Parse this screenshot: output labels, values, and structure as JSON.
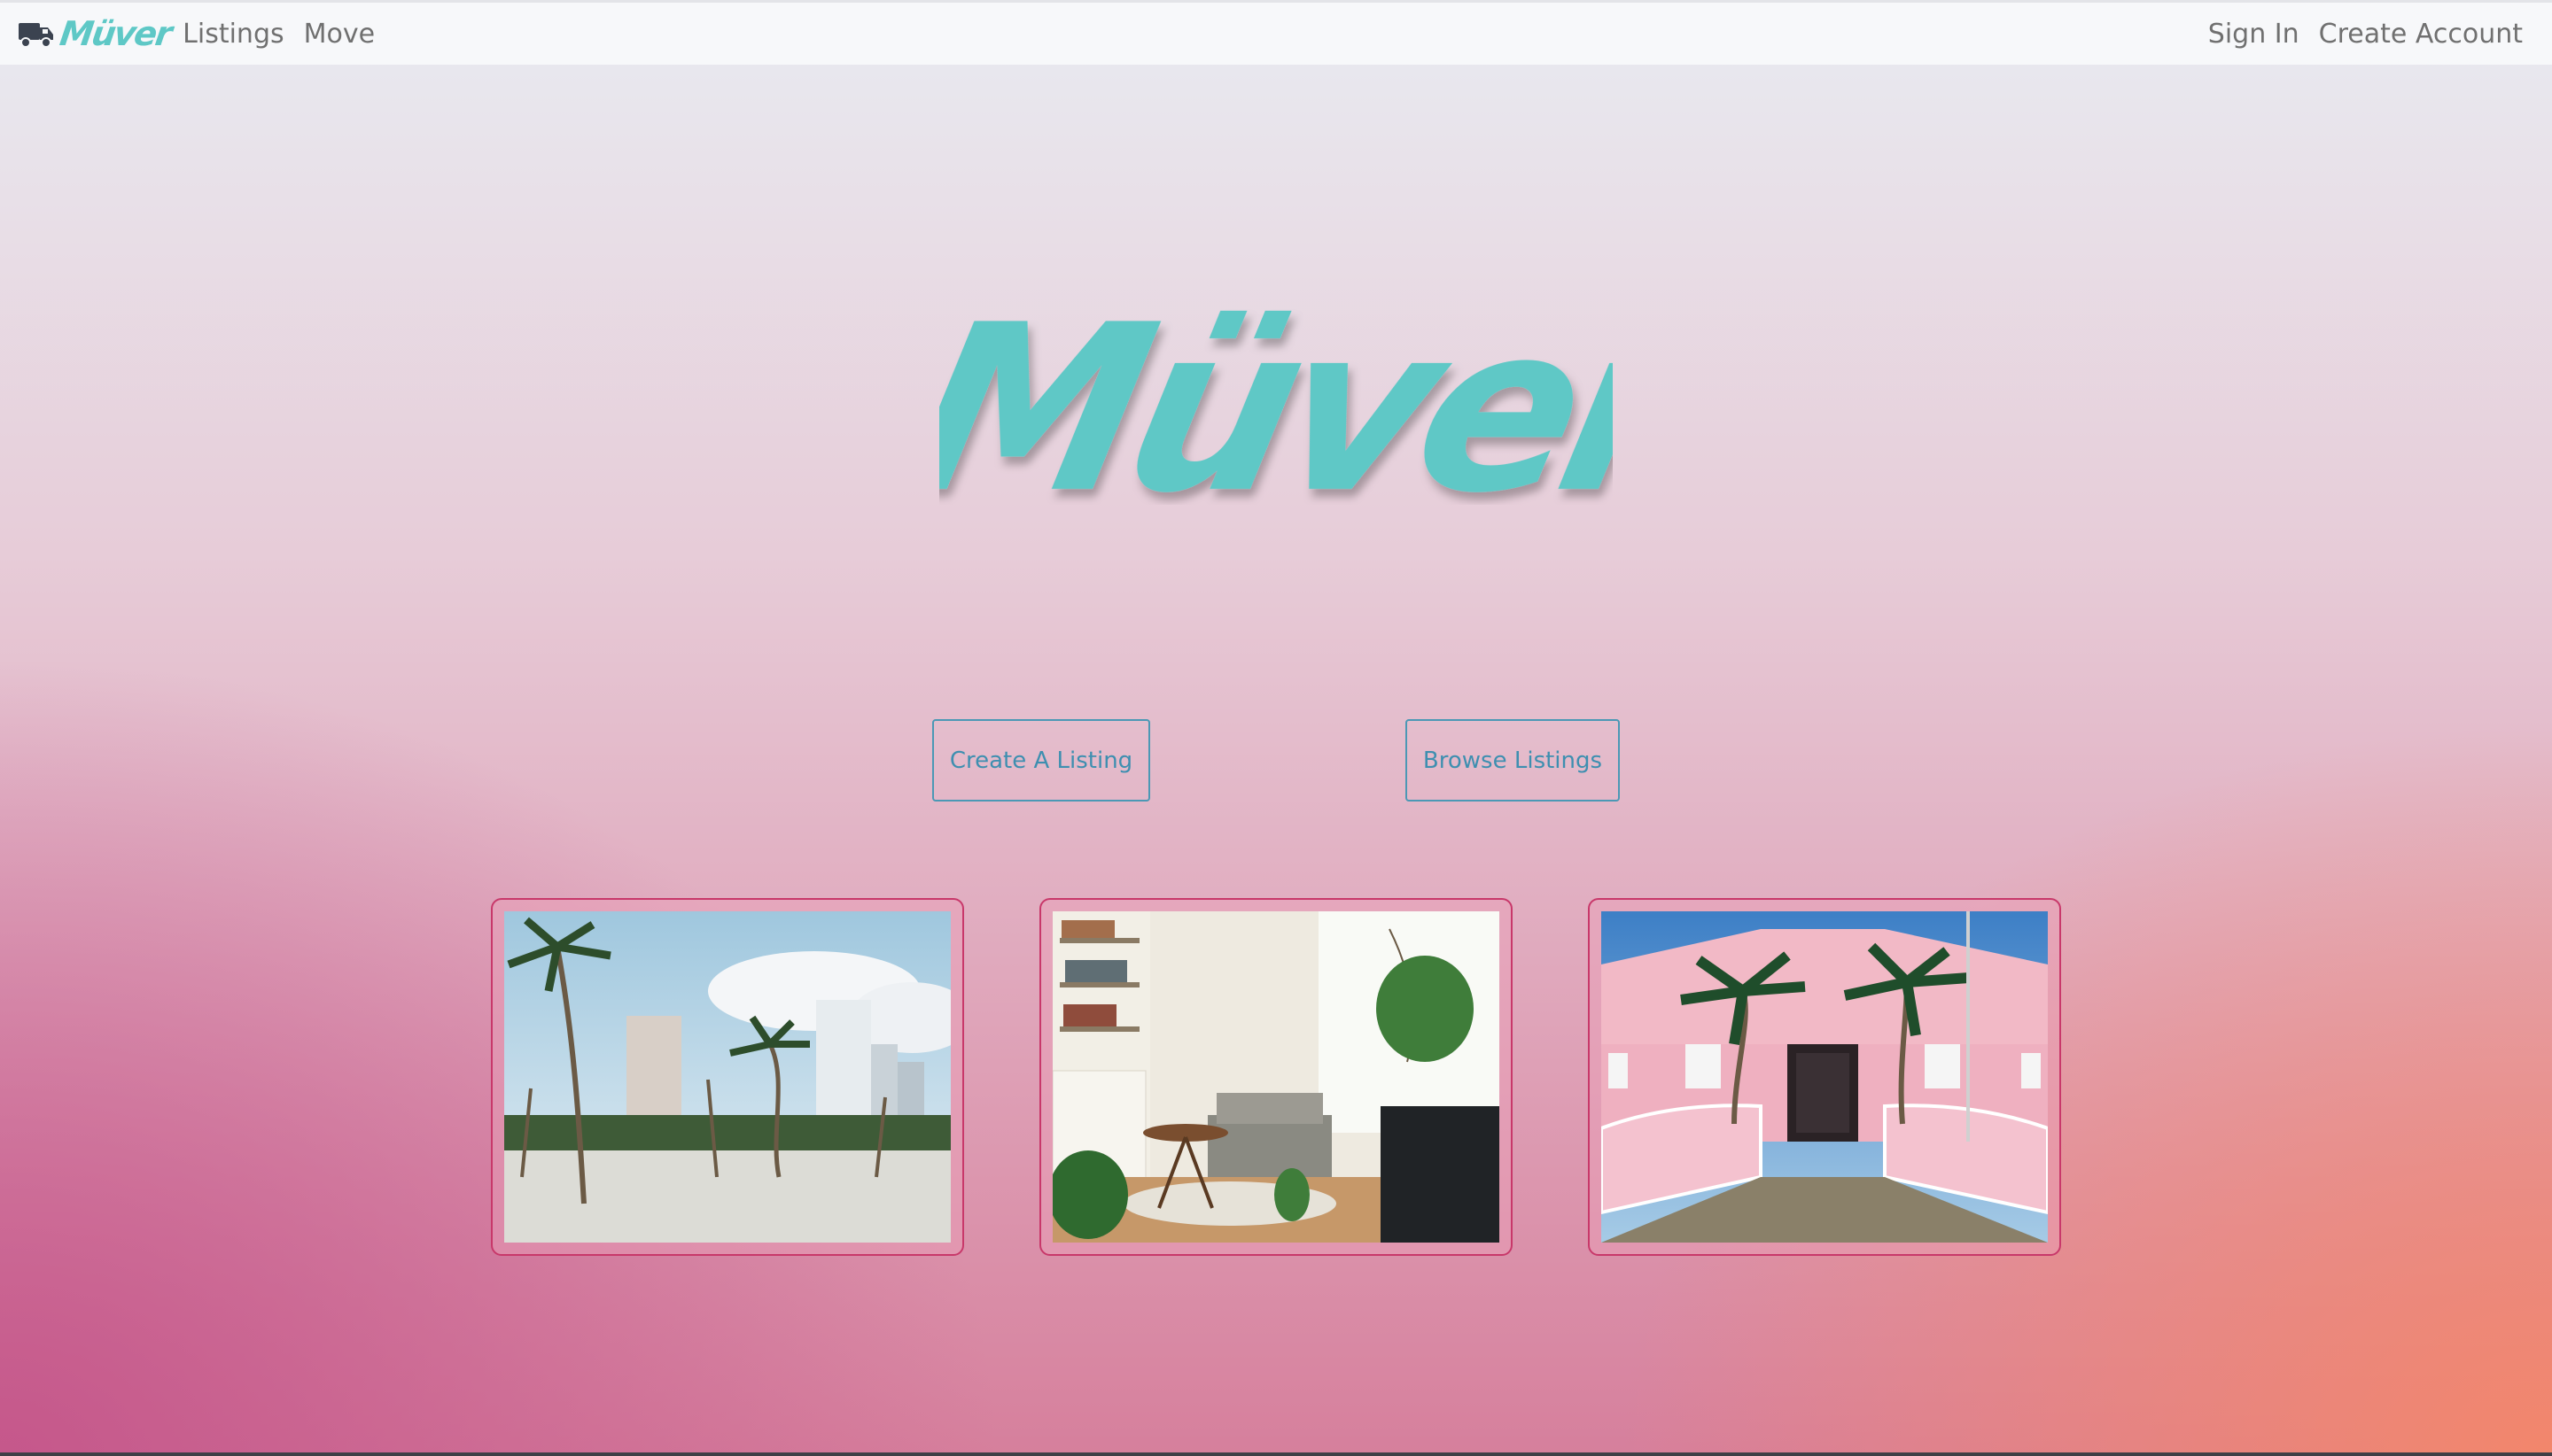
{
  "navbar": {
    "brand": "Müver",
    "links": [
      "Listings",
      "Move"
    ],
    "sign_in": "Sign In",
    "create_account": "Create Account"
  },
  "hero": {
    "logo_text": "Müver",
    "logo_color": "#5ec8c6"
  },
  "actions": {
    "create_listing": "Create A Listing",
    "browse_listings": "Browse Listings"
  },
  "gallery": [
    {
      "subject": "beach with palm trees and high-rise buildings"
    },
    {
      "subject": "living room with grey sofa, plants and bookshelf"
    },
    {
      "subject": "pink house with palm trees"
    }
  ],
  "colors": {
    "accent": "#5ec8c6",
    "button_border": "#4b98b5",
    "card_border": "#c8386a"
  }
}
